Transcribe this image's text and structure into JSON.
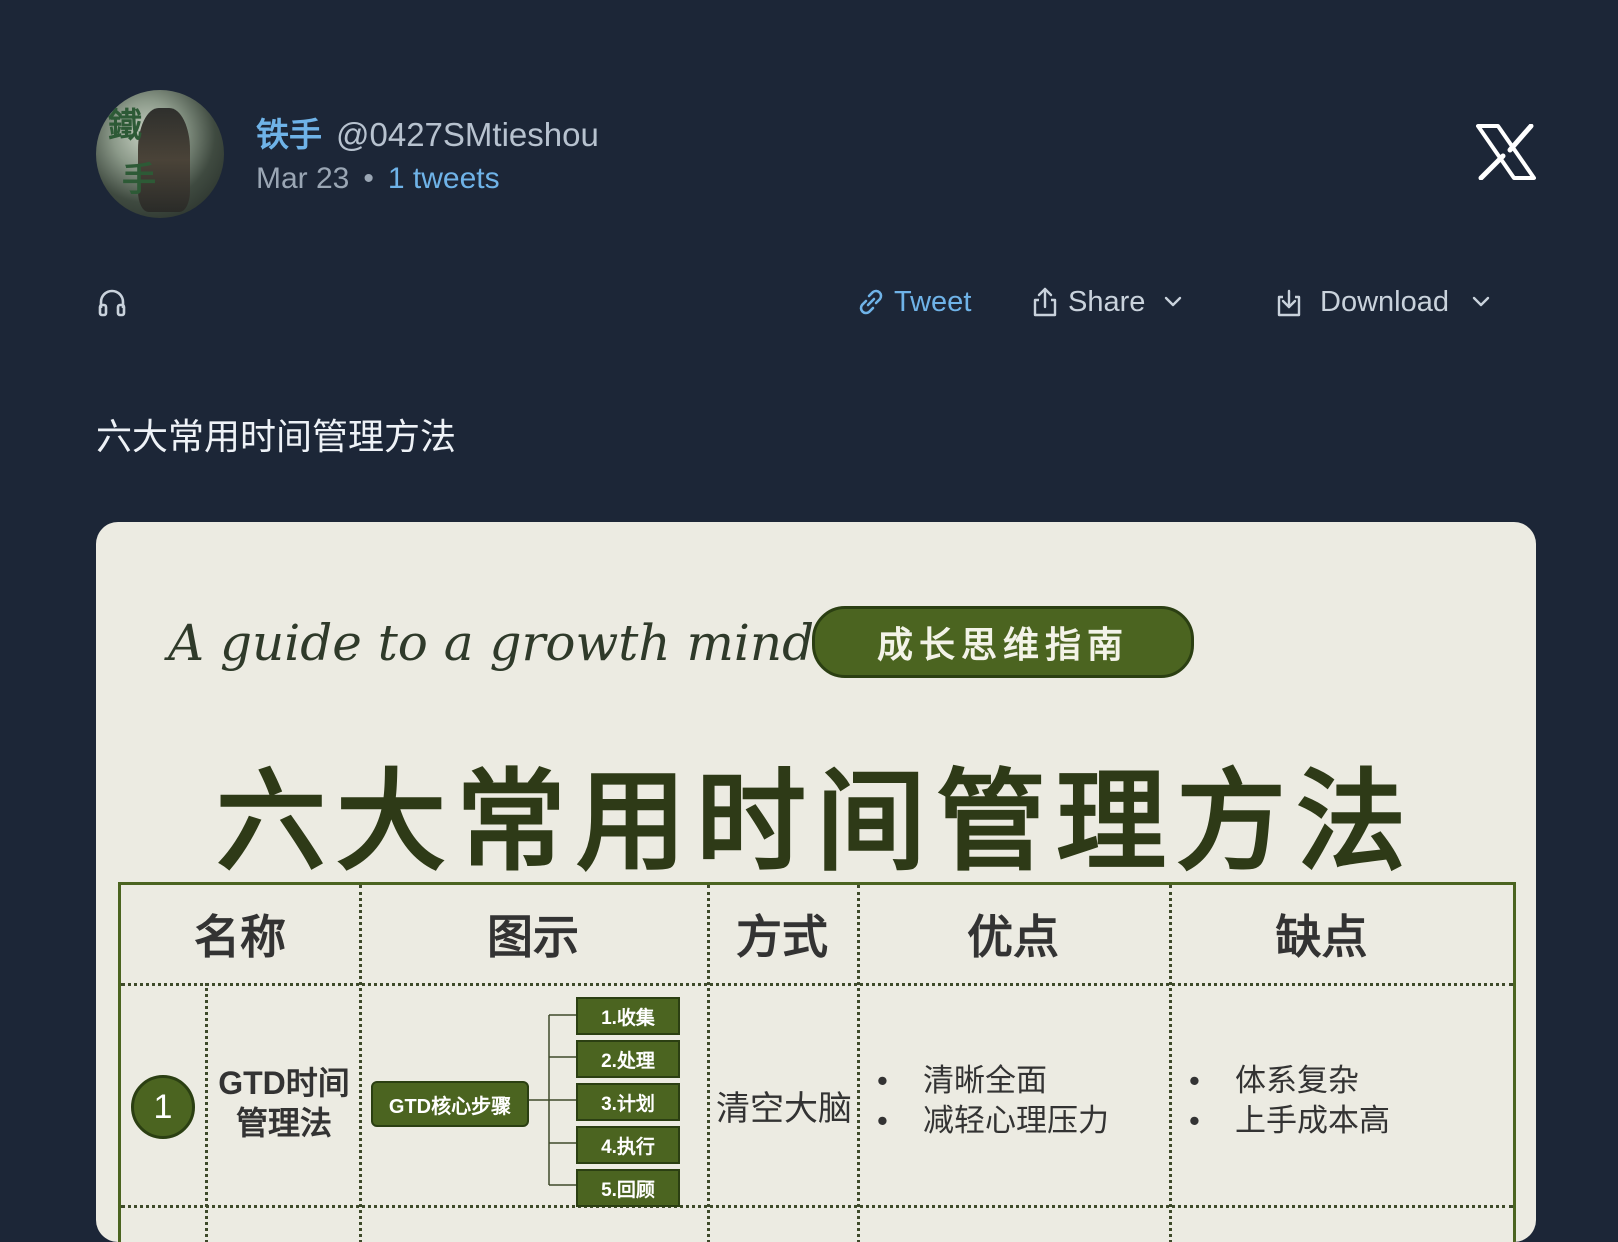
{
  "header": {
    "display_name": "铁手",
    "handle": "@0427SMtieshou",
    "date": "Mar 23",
    "separator": "•",
    "tweet_count": "1 tweets"
  },
  "toolbar": {
    "tweet_label": "Tweet",
    "share_label": "Share",
    "download_label": "Download"
  },
  "tweet": {
    "text": "六大常用时间管理方法"
  },
  "media": {
    "guide_script": "A guide to a growth mindset",
    "pill_label": "成长思维指南",
    "big_title": "六大常用时间管理方法",
    "table": {
      "columns": [
        "名称",
        "图示",
        "方式",
        "优点",
        "缺点"
      ],
      "row1": {
        "number": "1",
        "name_line1": "GTD时间",
        "name_line2": "管理法",
        "diagram_core": "GTD核心步骤",
        "steps": [
          "1.收集",
          "2.处理",
          "3.计划",
          "4.执行",
          "5.回顾"
        ],
        "method": "清空大脑",
        "pros": [
          "清晰全面",
          "减轻心理压力"
        ],
        "cons": [
          "体系复杂",
          "上手成本高"
        ],
        "bullet_mark": "•"
      }
    }
  },
  "colors": {
    "background": "#1c2637",
    "accent_blue": "#6fb3e8",
    "card_bg": "#ecebe2",
    "olive": "#4b6420"
  },
  "icons": [
    "headphones-icon",
    "link-icon",
    "share-icon",
    "chevron-down-icon",
    "download-icon",
    "x-logo-icon"
  ]
}
